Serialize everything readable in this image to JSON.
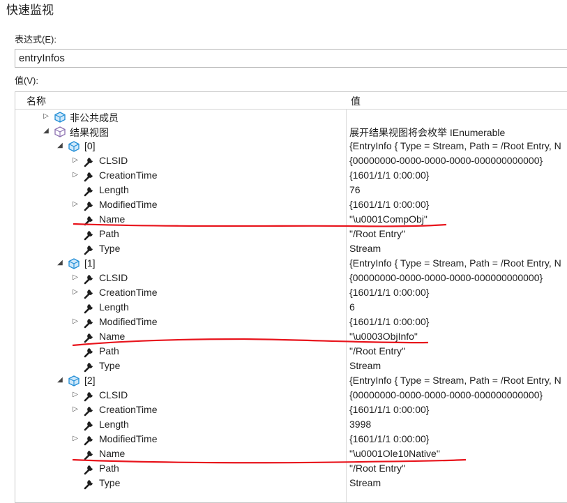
{
  "window": {
    "title": "快速监视"
  },
  "expression": {
    "label": "表达式(E):",
    "value": "entryInfos"
  },
  "value_label": "值(V):",
  "columns": {
    "name": "名称",
    "value": "值"
  },
  "rows": [
    {
      "name": "非公共成员",
      "value": "",
      "level": 0,
      "expander": "collapsed",
      "icon": "non-public-members-icon"
    },
    {
      "name": "结果视图",
      "value": "展开结果视图将会枚举 IEnumerable",
      "level": 0,
      "expander": "expanded",
      "icon": "results-view-icon"
    },
    {
      "name": "[0]",
      "value": "{EntryInfo { Type = Stream, Path = /Root Entry, N",
      "level": 1,
      "expander": "expanded",
      "icon": "object-icon"
    },
    {
      "name": "CLSID",
      "value": "{00000000-0000-0000-0000-000000000000}",
      "level": 2,
      "expander": "collapsed",
      "icon": "property-icon"
    },
    {
      "name": "CreationTime",
      "value": "{1601/1/1 0:00:00}",
      "level": 2,
      "expander": "collapsed",
      "icon": "property-icon"
    },
    {
      "name": "Length",
      "value": "76",
      "level": 2,
      "expander": "none",
      "icon": "property-icon"
    },
    {
      "name": "ModifiedTime",
      "value": "{1601/1/1 0:00:00}",
      "level": 2,
      "expander": "collapsed",
      "icon": "property-icon"
    },
    {
      "name": "Name",
      "value": "\"\\u0001CompObj\"",
      "level": 2,
      "expander": "none",
      "icon": "property-icon"
    },
    {
      "name": "Path",
      "value": "\"/Root Entry\"",
      "level": 2,
      "expander": "none",
      "icon": "property-icon"
    },
    {
      "name": "Type",
      "value": "Stream",
      "level": 2,
      "expander": "none",
      "icon": "property-icon"
    },
    {
      "name": "[1]",
      "value": "{EntryInfo { Type = Stream, Path = /Root Entry, N",
      "level": 1,
      "expander": "expanded",
      "icon": "object-icon"
    },
    {
      "name": "CLSID",
      "value": "{00000000-0000-0000-0000-000000000000}",
      "level": 2,
      "expander": "collapsed",
      "icon": "property-icon"
    },
    {
      "name": "CreationTime",
      "value": "{1601/1/1 0:00:00}",
      "level": 2,
      "expander": "collapsed",
      "icon": "property-icon"
    },
    {
      "name": "Length",
      "value": "6",
      "level": 2,
      "expander": "none",
      "icon": "property-icon"
    },
    {
      "name": "ModifiedTime",
      "value": "{1601/1/1 0:00:00}",
      "level": 2,
      "expander": "collapsed",
      "icon": "property-icon"
    },
    {
      "name": "Name",
      "value": "\"\\u0003ObjInfo\"",
      "level": 2,
      "expander": "none",
      "icon": "property-icon"
    },
    {
      "name": "Path",
      "value": "\"/Root Entry\"",
      "level": 2,
      "expander": "none",
      "icon": "property-icon"
    },
    {
      "name": "Type",
      "value": "Stream",
      "level": 2,
      "expander": "none",
      "icon": "property-icon"
    },
    {
      "name": "[2]",
      "value": "{EntryInfo { Type = Stream, Path = /Root Entry, N",
      "level": 1,
      "expander": "expanded",
      "icon": "object-icon"
    },
    {
      "name": "CLSID",
      "value": "{00000000-0000-0000-0000-000000000000}",
      "level": 2,
      "expander": "collapsed",
      "icon": "property-icon"
    },
    {
      "name": "CreationTime",
      "value": "{1601/1/1 0:00:00}",
      "level": 2,
      "expander": "collapsed",
      "icon": "property-icon"
    },
    {
      "name": "Length",
      "value": "3998",
      "level": 2,
      "expander": "none",
      "icon": "property-icon"
    },
    {
      "name": "ModifiedTime",
      "value": "{1601/1/1 0:00:00}",
      "level": 2,
      "expander": "collapsed",
      "icon": "property-icon"
    },
    {
      "name": "Name",
      "value": "\"\\u0001Ole10Native\"",
      "level": 2,
      "expander": "none",
      "icon": "property-icon"
    },
    {
      "name": "Path",
      "value": "\"/Root Entry\"",
      "level": 2,
      "expander": "none",
      "icon": "property-icon"
    },
    {
      "name": "Type",
      "value": "Stream",
      "level": 2,
      "expander": "none",
      "icon": "property-icon"
    }
  ],
  "colors": {
    "annotation_red": "#e8141c",
    "object_icon_blue": "#1f8dd6",
    "results_icon_purple": "#8b6fb0"
  }
}
